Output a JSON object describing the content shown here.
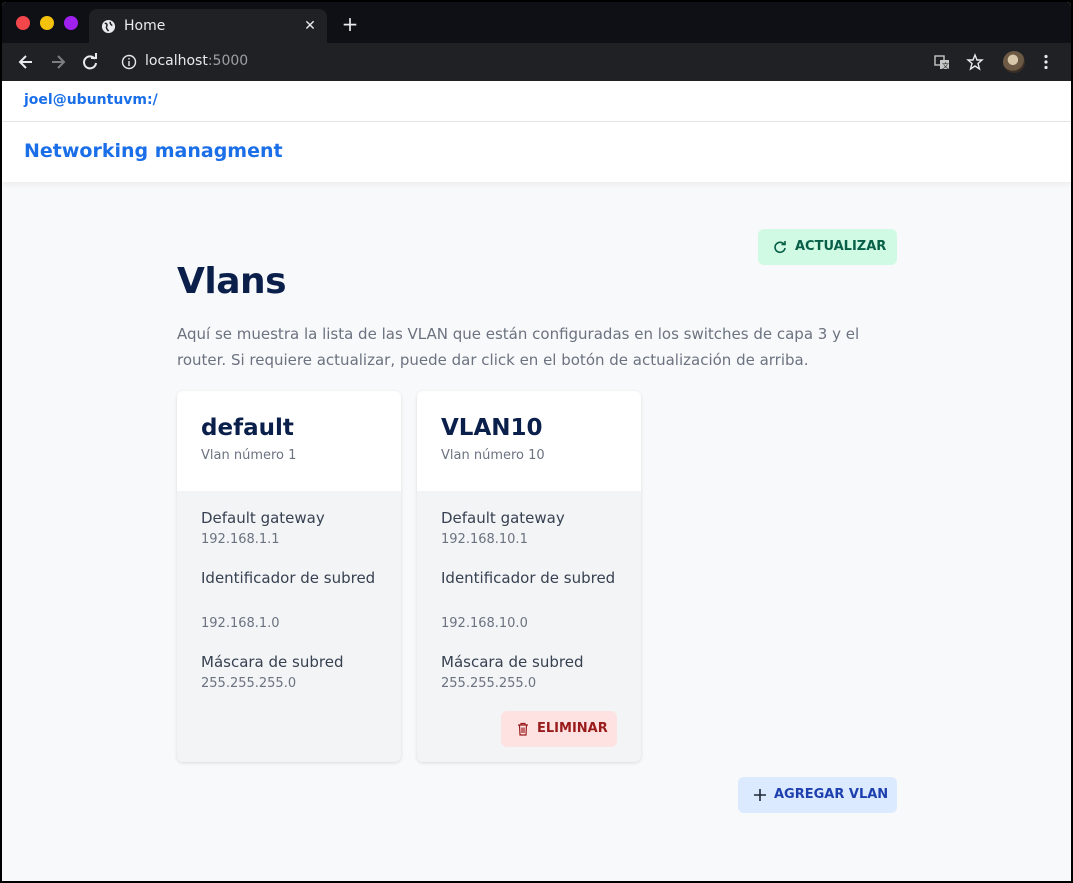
{
  "browser": {
    "tab_title": "Home",
    "url_host": "localhost",
    "url_port": ":5000"
  },
  "topline": {
    "text": "joel@ubuntuvm:/"
  },
  "header": {
    "brand": "Networking managment"
  },
  "toolbar": {
    "update_label": "ACTUALIZAR"
  },
  "main": {
    "title": "Vlans",
    "description": "Aquí se muestra la lista de las VLAN que están configuradas en los switches de capa 3 y el router. Si requiere actualizar, puede dar click en el botón de actualización de arriba."
  },
  "vlans": [
    {
      "name": "default",
      "number_text": "Vlan número 1",
      "gateway_label": "Default gateway",
      "gateway": "192.168.1.1",
      "subnet_id_label": "Identificador de subred",
      "subnet_id": "192.168.1.0",
      "mask_label": "Máscara de subred",
      "mask": "255.255.255.0"
    },
    {
      "name": "VLAN10",
      "number_text": "Vlan número 10",
      "gateway_label": "Default gateway",
      "gateway": "192.168.10.1",
      "subnet_id_label": "Identificador de subred",
      "subnet_id": "192.168.10.0",
      "mask_label": "Máscara de subred",
      "mask": "255.255.255.0",
      "delete_label": "ELIMINAR"
    }
  ],
  "actions": {
    "add_label": "AGREGAR VLAN"
  },
  "colors": {
    "brand": "#1a6fe8",
    "update_bg": "#d1fae5",
    "delete_bg": "#fee2e2",
    "add_bg": "#dbeafe"
  }
}
